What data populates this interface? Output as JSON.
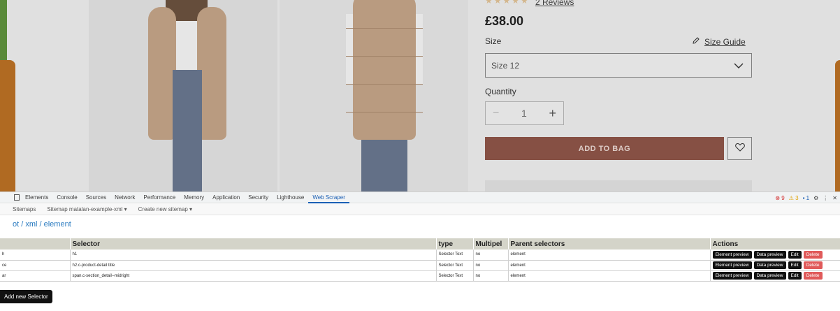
{
  "product": {
    "review_stars": "★★★★★",
    "reviews_link": "2 Reviews",
    "price": "£38.00",
    "size_label": "Size",
    "size_guide_label": "Size Guide",
    "size_selected": "Size 12",
    "quantity_label": "Quantity",
    "quantity_value": "1",
    "qty_minus": "−",
    "qty_plus": "+",
    "add_to_bag_label": "ADD TO BAG"
  },
  "devtools": {
    "tabs": [
      "Elements",
      "Console",
      "Sources",
      "Network",
      "Performance",
      "Memory",
      "Application",
      "Security",
      "Lighthouse",
      "Web Scraper"
    ],
    "active_tab": "Web Scraper",
    "error_count": "9",
    "warning_count": "3",
    "message_count": "1",
    "settings_glyph": "⚙",
    "more_glyph": "⋮",
    "close_glyph": "✕"
  },
  "scraper": {
    "nav": [
      "Sitemaps",
      "Sitemap matalan-example-xml ▾",
      "Create new sitemap ▾"
    ],
    "breadcrumb": "ot / xml / element",
    "columns": [
      "",
      "Selector",
      "type",
      "Multipel",
      "Parent selectors",
      "Actions"
    ],
    "rows": [
      {
        "id": "h",
        "selector": "h1",
        "type": "Selector Text",
        "multiple": "no",
        "parent": "element"
      },
      {
        "id": "ce",
        "selector": "h2.c-product-detail title",
        "type": "Selector Text",
        "multiple": "no",
        "parent": "element"
      },
      {
        "id": "ar",
        "selector": "span.c-section_detail--midright",
        "type": "Selector Text",
        "multiple": "no",
        "parent": "element"
      }
    ],
    "action_labels": {
      "preview": "Element preview",
      "data": "Data preview",
      "edit": "Edit",
      "delete": "Delete"
    },
    "add_selector_label": "Add new Selector"
  },
  "colors": {
    "add_to_bag": "#92574a",
    "link": "#2a7bc0",
    "table_header": "#d4d4c9",
    "delete": "#e05a5a",
    "orange_side": "#b06a22",
    "green_strip": "#5a8a3a"
  },
  "icons": [
    "pencil-icon",
    "chevron-down-icon",
    "heart-icon",
    "inspect-icon",
    "gear-icon",
    "more-icon",
    "close-icon"
  ]
}
